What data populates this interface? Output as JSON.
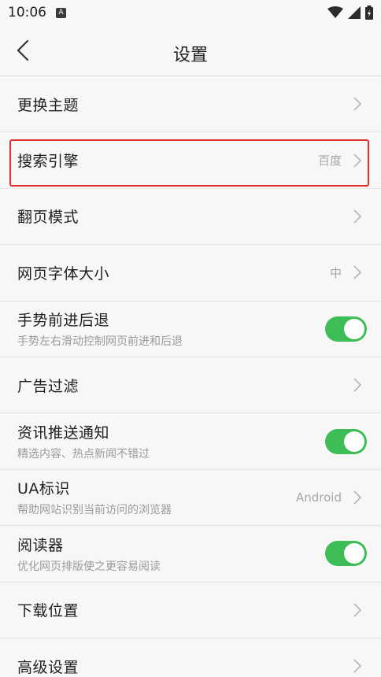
{
  "status_bar": {
    "time": "10:06",
    "notification_icon": "a-notification-icon",
    "icons": [
      "wifi-icon",
      "signal-icon",
      "battery-icon"
    ]
  },
  "header": {
    "title": "设置",
    "back_icon": "chevron-left-icon"
  },
  "settings": [
    {
      "label": "更换主题",
      "value": "",
      "sub": "",
      "control": "chevron"
    },
    {
      "label": "搜索引擎",
      "value": "百度",
      "sub": "",
      "control": "chevron"
    },
    {
      "label": "翻页模式",
      "value": "",
      "sub": "",
      "control": "chevron"
    },
    {
      "label": "网页字体大小",
      "value": "中",
      "sub": "",
      "control": "chevron"
    },
    {
      "label": "手势前进后退",
      "value": "",
      "sub": "手势左右滑动控制网页前进和后退",
      "control": "toggle",
      "on": true
    },
    {
      "label": "广告过滤",
      "value": "",
      "sub": "",
      "control": "chevron"
    },
    {
      "label": "资讯推送通知",
      "value": "",
      "sub": "精选内容、热点新闻不错过",
      "control": "toggle",
      "on": true
    },
    {
      "label": "UA标识",
      "value": "Android",
      "sub": "帮助网站识别当前访问的浏览器",
      "control": "chevron"
    },
    {
      "label": "阅读器",
      "value": "",
      "sub": "优化网页排版使之更容易阅读",
      "control": "toggle",
      "on": true
    },
    {
      "label": "下载位置",
      "value": "",
      "sub": "",
      "control": "chevron"
    },
    {
      "label": "高级设置",
      "value": "",
      "sub": "",
      "control": "chevron"
    }
  ],
  "colors": {
    "toggle_on": "#3dbd55",
    "highlight_border": "#e0302b"
  }
}
